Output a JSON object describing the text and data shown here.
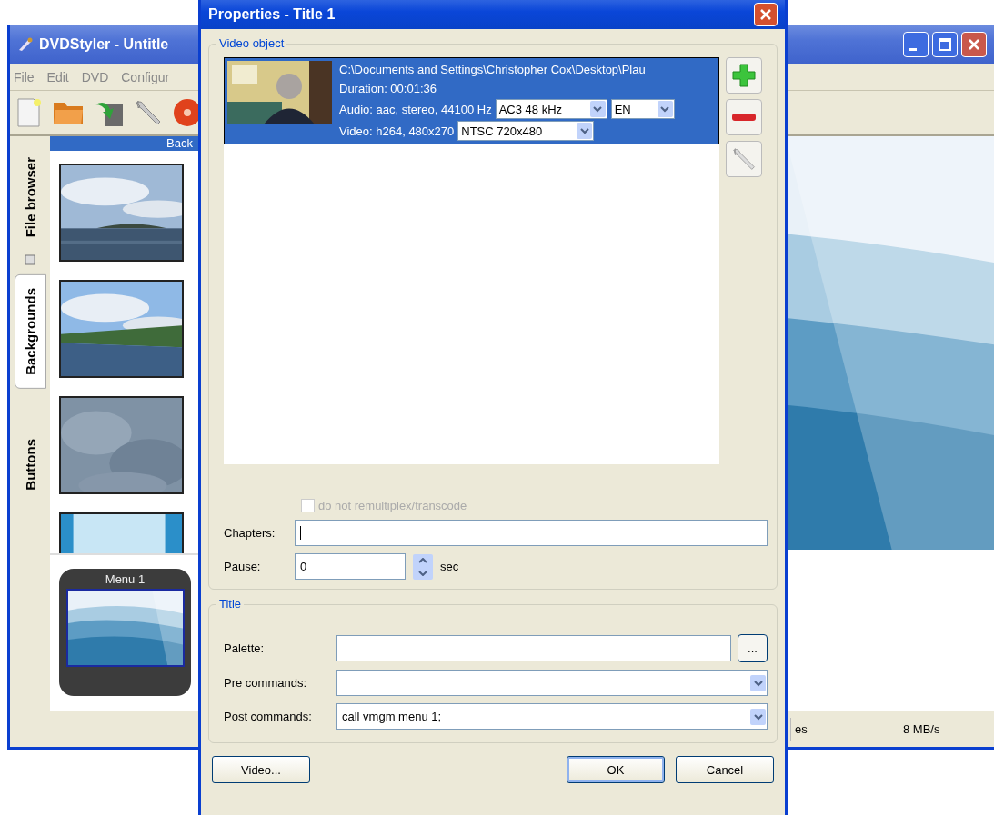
{
  "main_window": {
    "title": "DVDStyler - Untitle",
    "menu": [
      "File",
      "Edit",
      "DVD",
      "Configur"
    ],
    "side_tabs": [
      {
        "label": "File browser",
        "selected": false
      },
      {
        "label": "Backgrounds",
        "selected": true
      },
      {
        "label": "Buttons",
        "selected": false
      }
    ],
    "panel_header": "Back",
    "thumbnails": [
      {
        "kind": "picture"
      },
      {
        "kind": "picture"
      },
      {
        "kind": "picture"
      },
      {
        "kind": "picture"
      }
    ],
    "menus": [
      {
        "label": "Menu 1"
      }
    ],
    "status_bar": [
      "es",
      "8 MB/s"
    ]
  },
  "dialog": {
    "title": "Properties - Title 1",
    "video_object": {
      "label": "Video object",
      "items": [
        {
          "selected": true,
          "path": "C:\\Documents and Settings\\Christopher Cox\\Desktop\\Plau",
          "duration": "Duration: 00:01:36",
          "audio": "Audio: aac, stereo, 44100 Hz",
          "audio_format": "AC3 48 kHz",
          "language": "EN",
          "video": "Video: h264, 480x270",
          "video_format": "NTSC 720x480"
        }
      ],
      "remux": {
        "label": "do not remultiplex/transcode",
        "checked": false,
        "disabled": true
      },
      "chapters": {
        "label": "Chapters:",
        "focused": true
      },
      "pause": {
        "label": "Pause:",
        "value": "0",
        "unit": "sec"
      }
    },
    "title_group": {
      "label": "Title",
      "palette": {
        "label": "Palette:",
        "button": "..."
      },
      "pre_commands": {
        "label": "Pre commands:"
      },
      "post_commands": {
        "label": "Post commands:",
        "value": "call vmgm menu 1;"
      }
    },
    "buttons": [
      "Video...",
      "OK",
      "Cancel"
    ]
  }
}
